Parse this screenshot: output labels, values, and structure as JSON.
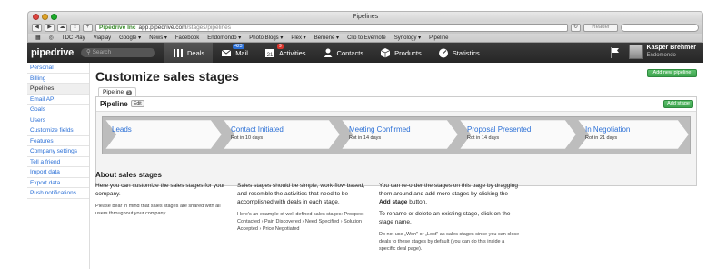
{
  "window": {
    "title": "Pipelines"
  },
  "toolbar": {
    "secure_label": "Pipedrive Inc",
    "url_host": "app.pipedrive.com",
    "url_path": "/stages/pipelines",
    "reader_label": "Reader"
  },
  "bookmarks": [
    "TDC Play",
    "Viaplay",
    "Google ▾",
    "News ▾",
    "Facebook",
    "Endomondo ▾",
    "Photo Blogs ▾",
    "Plex ▾",
    "Bernene ▾",
    "Clip to Evernote",
    "Synology ▾",
    "Pipeline"
  ],
  "appnav": {
    "logo": "pipedrive",
    "search_placeholder": "Search",
    "items": [
      {
        "label": "Deals",
        "icon": "deals-icon"
      },
      {
        "label": "Mail",
        "icon": "mail-icon",
        "badge": "423"
      },
      {
        "label": "Activities",
        "icon": "calendar-icon",
        "badge": "9"
      },
      {
        "label": "Contacts",
        "icon": "contacts-icon"
      },
      {
        "label": "Products",
        "icon": "products-icon"
      },
      {
        "label": "Statistics",
        "icon": "statistics-icon"
      }
    ],
    "user": {
      "name": "Kasper Brehmer",
      "company": "Endomondo"
    }
  },
  "sidebar": {
    "items": [
      {
        "label": "Personal"
      },
      {
        "label": "Billing"
      },
      {
        "label": "Pipelines",
        "active": true
      },
      {
        "label": "Email API"
      },
      {
        "label": "Goals"
      },
      {
        "label": "Users"
      },
      {
        "label": "Customize fields"
      },
      {
        "label": "Features"
      },
      {
        "label": "Company settings"
      },
      {
        "label": "Tell a friend"
      },
      {
        "label": "Import data"
      },
      {
        "label": "Export data"
      },
      {
        "label": "Push notifications"
      }
    ]
  },
  "main": {
    "title": "Customize sales stages",
    "add_pipeline_label": "Add new pipeline",
    "tab_label": "Pipeline",
    "tab_count": "5",
    "pipeline_name": "Pipeline",
    "edit_label": "Edit",
    "add_stage_label": "Add stage",
    "stages": [
      {
        "name": "Leads",
        "rot": ""
      },
      {
        "name": "Contact Initiated",
        "rot": "Rot in 10 days"
      },
      {
        "name": "Meeting Confirmed",
        "rot": "Rot in 14 days"
      },
      {
        "name": "Proposal Presented",
        "rot": "Rot in 14 days"
      },
      {
        "name": "In Negotiation",
        "rot": "Rot in 21 days"
      }
    ],
    "about": {
      "title": "About sales stages",
      "col1_text": "Here you can customize the sales stages for your company.",
      "col1_small": "Please bear in mind that sales stages are shared with all users throughout your company.",
      "col2_text": "Sales stages should be simple, work-flow based, and resemble the activities that need to be accomplished with deals in each stage.",
      "col2_small": "Here's an example of well defined sales stages: Prospect Contacted › Pain Discovered › Need Specified › Solution Accepted › Price Negotiated",
      "col3_text_a": "You can re-order the stages on this page by dragging them around and add more stages by clicking the ",
      "col3_bold": "Add stage",
      "col3_text_b": " button.",
      "col3_text2": "To rename or delete an existing stage, click on the stage name.",
      "col3_small": "Do not use „Won\" or „Lost\" as sales stages since you can close deals to these stages by default (you can do this inside a specific deal page)."
    }
  }
}
